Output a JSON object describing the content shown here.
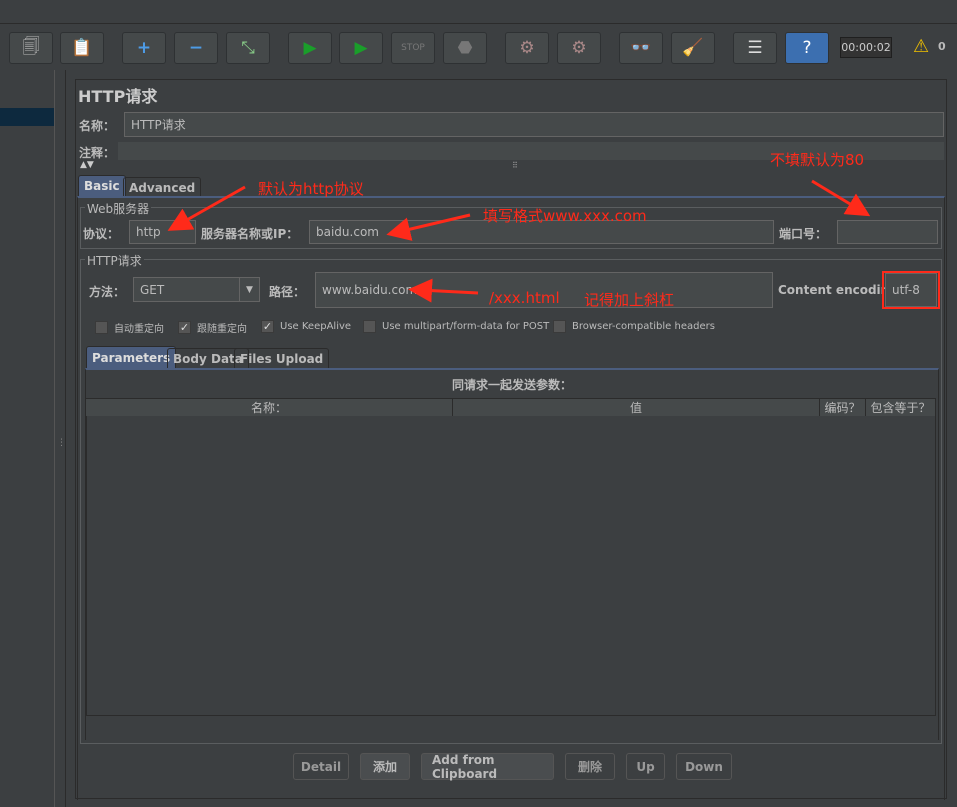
{
  "toolbar": {
    "buttons": [
      "templates-icon",
      "clipboard-icon",
      "expand-icon",
      "collapse-icon",
      "toggle-icon",
      "start-icon",
      "start-no-pause-icon",
      "stop-icon",
      "shutdown-icon",
      "clear-icon",
      "clear-all-icon",
      "search-icon",
      "reset-search-icon",
      "function-helper-icon",
      "help-icon"
    ],
    "timer": "00:00:02",
    "warning_count": "0"
  },
  "panel": {
    "title": "HTTP请求",
    "name_label": "名称：",
    "name_value": "HTTP请求",
    "comment_label": "注释：",
    "comment_value": ""
  },
  "tabs": [
    "Basic",
    "Advanced"
  ],
  "web_server": {
    "title": "Web服务器",
    "protocol_label": "协议：",
    "protocol_value": "http",
    "server_label": "服务器名称或IP：",
    "server_value": "baidu.com",
    "port_label": "端口号：",
    "port_value": ""
  },
  "http_request": {
    "title": "HTTP请求",
    "method_label": "方法：",
    "method_value": "GET",
    "path_label": "路径：",
    "path_value": "www.baidu.com",
    "encoding_label": "Content encoding:",
    "encoding_value": "utf-8",
    "checkboxes": [
      {
        "label": "自动重定向",
        "checked": false
      },
      {
        "label": "跟随重定向",
        "checked": true
      },
      {
        "label": "Use KeepAlive",
        "checked": true
      },
      {
        "label": "Use multipart/form-data for POST",
        "checked": false
      },
      {
        "label": "Browser-compatible headers",
        "checked": false
      }
    ]
  },
  "sub_tabs": [
    "Parameters",
    "Body Data",
    "Files Upload"
  ],
  "params": {
    "title": "同请求一起发送参数：",
    "columns": [
      "名称：",
      "值",
      "编码？",
      "包含等于？"
    ],
    "rows": []
  },
  "buttons": {
    "detail": "Detail",
    "add": "添加",
    "add_clipboard": "Add from Clipboard",
    "delete": "删除",
    "up": "Up",
    "down": "Down"
  },
  "annotations": {
    "protocol_note": "默认为http协议",
    "server_note": "填写格式www.xxx.com",
    "port_note": "不填默认为80",
    "path_note1": "/xxx.html",
    "path_note2": "记得加上斜杠",
    "color": "#ff2a1a"
  }
}
